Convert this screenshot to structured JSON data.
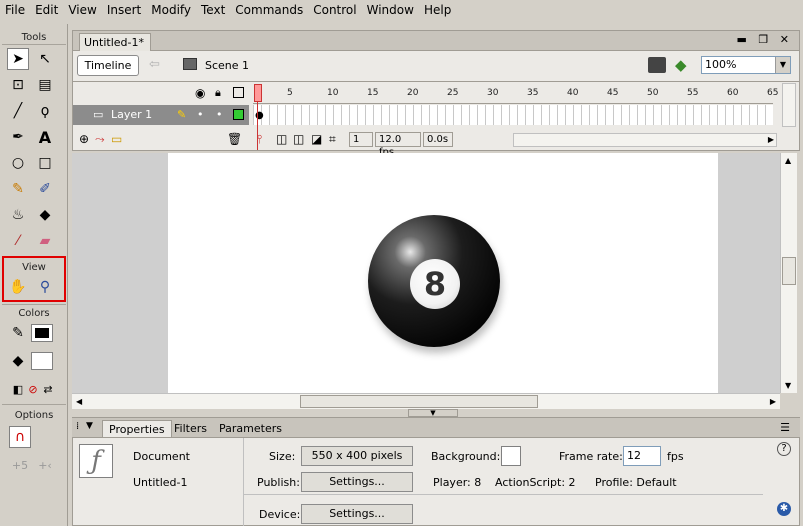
{
  "menu": [
    "File",
    "Edit",
    "View",
    "Insert",
    "Modify",
    "Text",
    "Commands",
    "Control",
    "Window",
    "Help"
  ],
  "tools": {
    "header": "Tools",
    "view_header": "View",
    "colors_header": "Colors",
    "options_header": "Options",
    "items": [
      "arrow-icon",
      "subselect-icon",
      "free-transform-icon",
      "gradient-transform-icon",
      "line-icon",
      "lasso-icon",
      "pen-icon",
      "text-icon",
      "oval-icon",
      "rectangle-icon",
      "pencil-icon",
      "brush-icon",
      "ink-bottle-icon",
      "paint-bucket-icon",
      "eyedropper-icon",
      "eraser-icon"
    ],
    "view_items": [
      "hand-icon",
      "zoom-icon"
    ],
    "stroke_color": "#000000",
    "fill_color": "#ffffff"
  },
  "document": {
    "tab_title": "Untitled-1*",
    "timeline_button": "Timeline",
    "scene_label": "Scene 1",
    "zoom": "100%"
  },
  "timeline": {
    "layer_name": "Layer 1",
    "frame_numbers": [
      "1",
      "5",
      "10",
      "15",
      "20",
      "25",
      "30",
      "35",
      "40",
      "45",
      "50",
      "55",
      "60",
      "65"
    ],
    "current_frame": "1",
    "fps": "12.0 fps",
    "elapsed": "0.0s"
  },
  "stage": {
    "ball_number": "8",
    "ball_color": "#000000"
  },
  "properties": {
    "tabs": [
      "Properties",
      "Filters",
      "Parameters"
    ],
    "doc_type": "Document",
    "doc_name": "Untitled-1",
    "size_label": "Size:",
    "size_value": "550 x 400 pixels",
    "background_label": "Background:",
    "frame_rate_label": "Frame rate:",
    "frame_rate_value": "12",
    "fps_unit": "fps",
    "publish_label": "Publish:",
    "settings_button": "Settings...",
    "player_text": "Player: 8",
    "actionscript_text": "ActionScript: 2",
    "profile_text": "Profile: Default",
    "device_label": "Device:",
    "device_button": "Settings..."
  }
}
